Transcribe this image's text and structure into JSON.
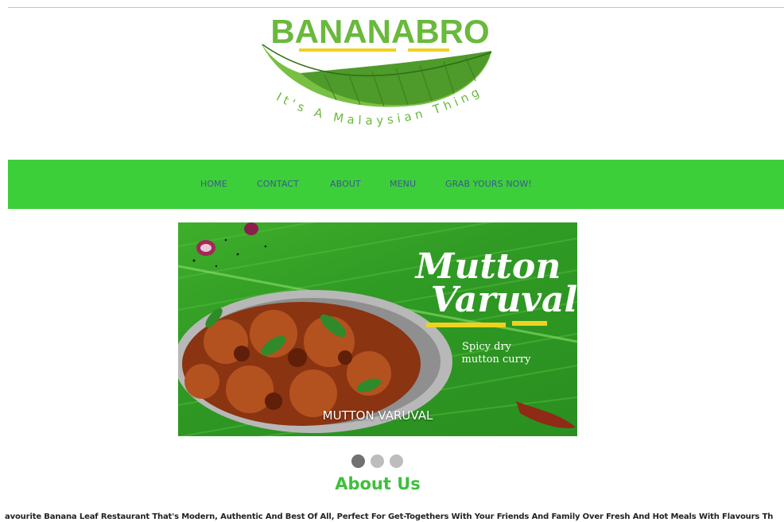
{
  "brand": {
    "name": "BANANABRO",
    "tagline": "It's A Malaysian Thing",
    "primary_green": "#3dcf3a",
    "accent_yellow": "#f0d21e"
  },
  "nav": {
    "items": [
      {
        "label": "HOME"
      },
      {
        "label": "CONTACT"
      },
      {
        "label": "ABOUT"
      },
      {
        "label": "MENU"
      },
      {
        "label": "GRAB YOURS NOW!"
      }
    ]
  },
  "slider": {
    "active_index": 0,
    "slide_count": 3,
    "slide": {
      "title_line1": "Mutton",
      "title_line2": "Varuval",
      "subtitle_line1": "Spicy dry",
      "subtitle_line2": "mutton curry",
      "caption": "MUTTON VARUVAL"
    }
  },
  "about": {
    "title": "About Us",
    "text": "avourite Banana Leaf Restaurant That's Modern, Authentic And Best Of All, Perfect For Get-Togethers With Your Friends And Family Over Fresh And Hot Meals With Flavours Th"
  }
}
